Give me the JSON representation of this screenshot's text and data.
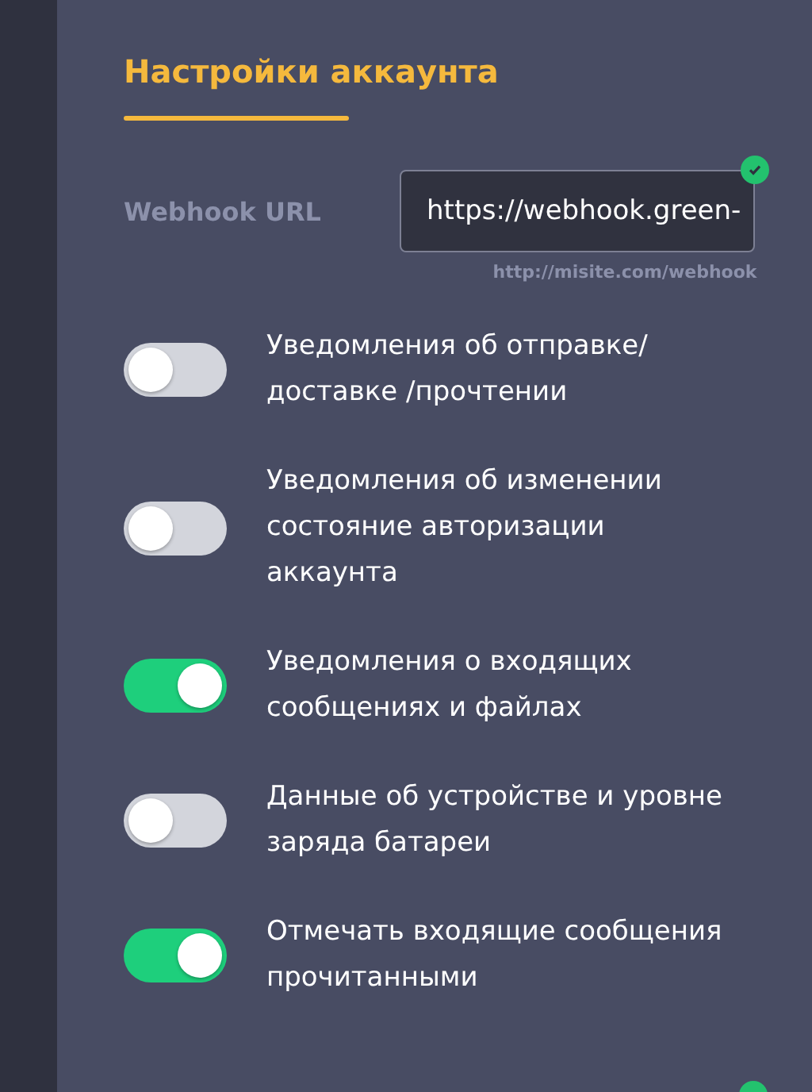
{
  "section": {
    "title": "Настройки аккаунта"
  },
  "webhook": {
    "label": "Webhook URL",
    "value": "https://webhook.green-",
    "valid": true,
    "hint": "http://misite.com/webhook"
  },
  "settings": [
    {
      "label": "Уведомления об отправке/доставке /прочтении",
      "on": false
    },
    {
      "label": "Уведомления об изменении состояние авторизации аккаунта",
      "on": false
    },
    {
      "label": "Уведомления о входящих сообщениях и файлах",
      "on": true
    },
    {
      "label": "Данные об устройстве и уровне заряда батареи",
      "on": false
    },
    {
      "label": "Отмечать входящие сообщения прочитанными",
      "on": true
    }
  ]
}
